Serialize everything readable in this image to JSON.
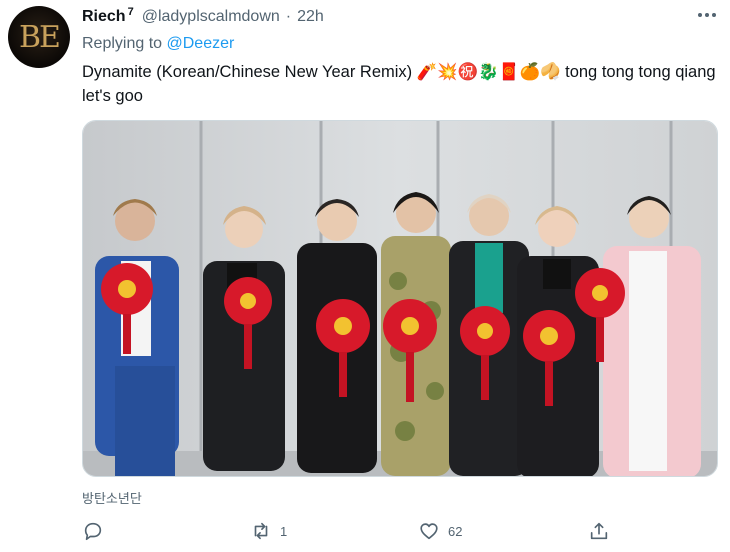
{
  "author": {
    "avatar_text": "BE",
    "display_name": "Riech",
    "superscript": "7",
    "handle": "@ladyplscalmdown",
    "separator": "·",
    "time": "22h"
  },
  "reply_context": {
    "prefix": "Replying to",
    "mention": "@Deezer"
  },
  "tweet": {
    "text": "Dynamite (Korean/Chinese New Year Remix) 🧨💥㊗️🐉🧧🍊🥠 tong tong tong qiang let's goo"
  },
  "media": {
    "alt": "",
    "caption": "방탄소년단"
  },
  "actions": {
    "reply_count": "",
    "retweet_count": "1",
    "like_count": "62",
    "share_count": ""
  },
  "icons": [
    "more-icon",
    "reply-icon",
    "retweet-icon",
    "like-icon",
    "share-icon"
  ],
  "colors": {
    "link": "#1d9bf0",
    "secondary_text": "#536471",
    "lantern_red": "#d7192a",
    "lantern_gold": "#f2c230"
  }
}
